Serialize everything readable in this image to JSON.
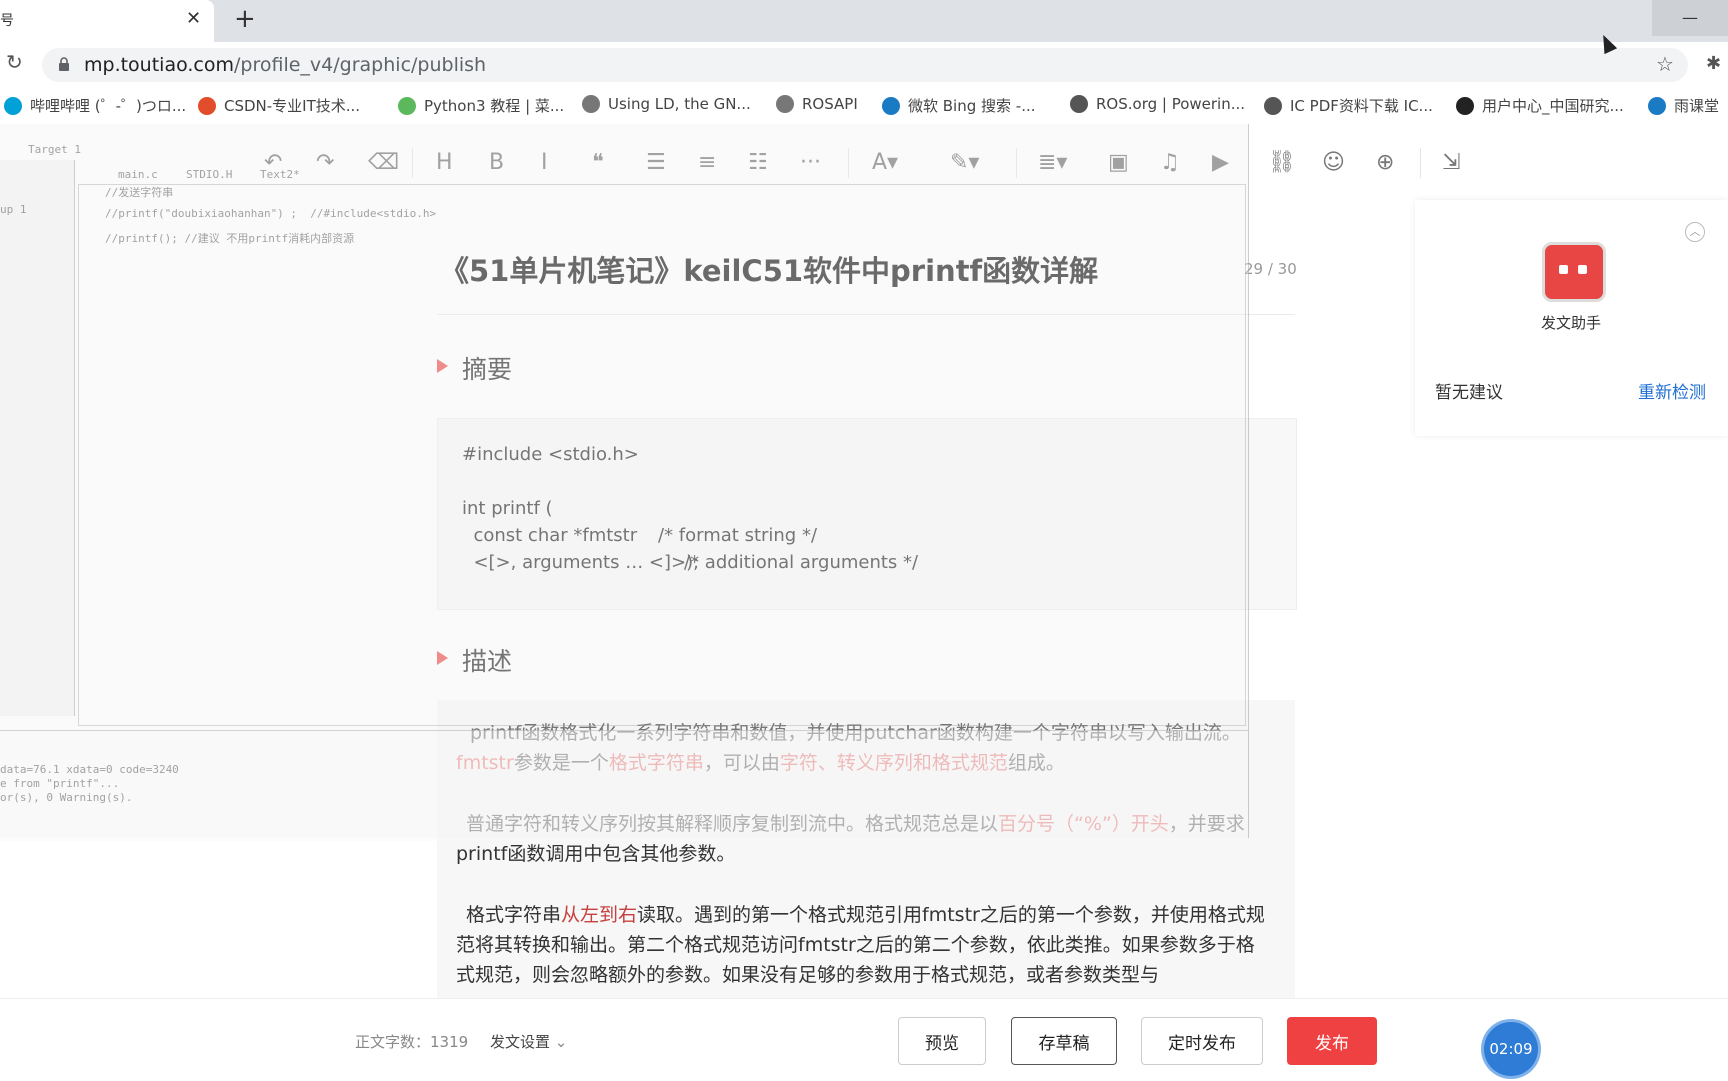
{
  "browser": {
    "tab_title": "号",
    "url_host": "mp.toutiao.com",
    "url_path": "/profile_v4/graphic/publish"
  },
  "bookmarks": [
    {
      "label": "哔哩哔哩 (゜-゜)つロ...",
      "color": "#00a1d6"
    },
    {
      "label": "CSDN-专业IT技术...",
      "color": "#e14d2a"
    },
    {
      "label": "Python3 教程 | 菜...",
      "color": "#5cb85c"
    },
    {
      "label": "Using LD, the GN...",
      "color": "#777777"
    },
    {
      "label": "ROSAPI",
      "color": "#777777"
    },
    {
      "label": "微软 Bing 搜索 -...",
      "color": "#1a7ac4"
    },
    {
      "label": "ROS.org | Powerin...",
      "color": "#555555"
    },
    {
      "label": "IC PDF资料下载 IC...",
      "color": "#555555"
    },
    {
      "label": "用户中心_中国研究...",
      "color": "#222222"
    },
    {
      "label": "雨课堂",
      "color": "#1a7ac4"
    }
  ],
  "editor_toolbar": [
    "undo-icon",
    "redo-icon",
    "eraser-icon",
    "heading-icon",
    "bold-icon",
    "italic-icon",
    "quote-icon",
    "bullet-list-icon",
    "ordered-list-icon",
    "divider-icon",
    "more-icon",
    "font-color-icon",
    "highlight-icon",
    "align-icon",
    "image-icon",
    "audio-icon",
    "video-icon",
    "link-icon",
    "emoji-icon",
    "insert-icon",
    "import-icon"
  ],
  "article": {
    "title": "《51单片机笔记》keilC51软件中printf函数详解",
    "title_counter": "29 / 30",
    "section1": "摘要",
    "code_lines": [
      "#include <stdio.h>",
      "",
      "int printf (",
      "  const char *fmtstr",
      "  <[>, arguments … <]>);"
    ],
    "code_comments": [
      "/* format string */",
      "/* additional arguments */"
    ],
    "section2": "描述",
    "para1": {
      "line1": "printf函数格式化一系列字符串和数值，并使用putchar函数构建一个字符串以写入输出流。",
      "p2a": "fmtstr",
      "p2b": "参数是一个",
      "p2c": "格式字符串",
      "p2d": "，可以由",
      "p2e": "字符、转义序列和格式规范",
      "p2f": "组成。"
    },
    "para2": {
      "a": "普通字符和转义序列按其解释顺序复制到流中。格式规范总是以",
      "b": "百分号（“%”）开头",
      "c": "，并要求printf函数调用中包含其他参数。"
    },
    "para3": {
      "a": "格式字符串",
      "b": "从左到右",
      "c": "读取。遇到的第一个格式规范引用fmtstr之后的第一个参数，并使用格式规范将其转换和输出。第二个格式规范访问fmtstr之后的第二个参数，依此类推。如果参数多于格式规范，则会忽略额外的参数。如果没有足够的参数用于格式规范，或者参数类型与"
    }
  },
  "ghost_ide": {
    "target": "Target 1",
    "tabs": [
      "main.c",
      "STDIO.H",
      "Text2*"
    ],
    "group": "up 1",
    "code": [
      "//发送字符串",
      "//printf(\"doubixiaohanhan\") ;  //#include<stdio.h>",
      "//printf(); //建议 不用printf消耗内部资源"
    ],
    "output": [
      "data=76.1 xdata=0 code=3240",
      "e from \"printf\"...",
      "or(s), 0 Warning(s)."
    ]
  },
  "assistant": {
    "name": "发文助手",
    "no_suggestion": "暂无建议",
    "recheck": "重新检测"
  },
  "footer": {
    "word_count_label": "正文字数：1319",
    "settings": "发文设置",
    "preview": "预览",
    "save_draft": "存草稿",
    "schedule": "定时发布",
    "publish": "发布",
    "timer": "02:09"
  }
}
